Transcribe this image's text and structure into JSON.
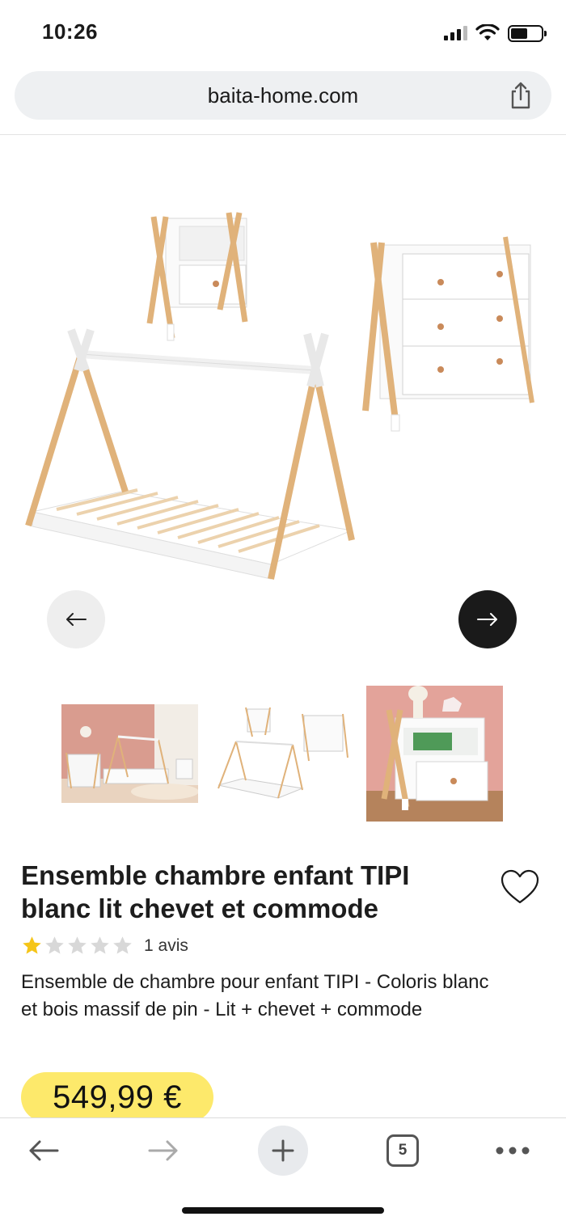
{
  "status_bar": {
    "time": "10:26"
  },
  "browser": {
    "url": "baita-home.com",
    "tab_count": "5"
  },
  "product": {
    "title_line1": "Ensemble chambre enfant TIPI",
    "title_line2": "blanc lit chevet et commode",
    "rating": 1,
    "rating_max": 5,
    "review_count": "1 avis",
    "description_line1": "Ensemble de chambre pour enfant TIPI - Coloris blanc",
    "description_line2": "et bois massif de pin - Lit + chevet + commode",
    "price": "549,99 €"
  },
  "gallery": {
    "thumbnails": [
      {
        "name": "room-scene"
      },
      {
        "name": "dimension-diagram"
      },
      {
        "name": "nightstand-closeup"
      }
    ]
  },
  "colors": {
    "price_highlight": "#fde96b",
    "star_filled": "#f5c518",
    "star_empty": "#d8d8d8",
    "next_button": "#1a1a1a",
    "wood": "#e0b27a"
  }
}
